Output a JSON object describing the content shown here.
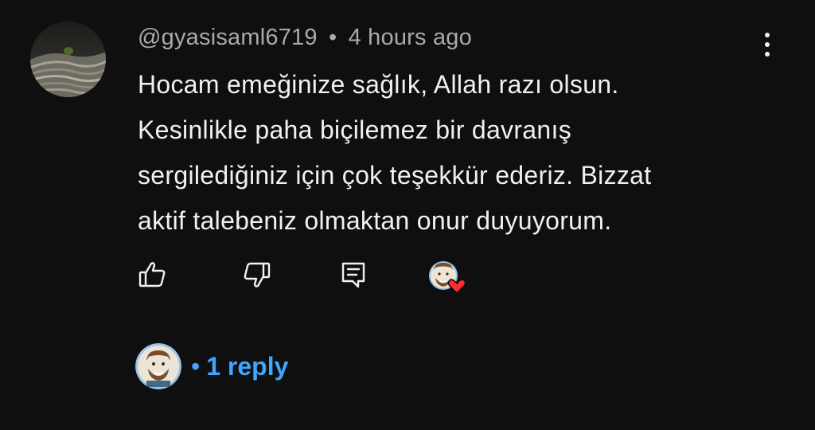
{
  "comment": {
    "author": "@gyasisaml6719",
    "separator": "•",
    "time": "4 hours ago",
    "lines": [
      "Hocam emeğinize sağlık, Allah razı olsun.",
      "Kesinlikle paha biçilemez bir davranış",
      "sergilediğiniz için çok teşekkür ederiz. Bizzat",
      "aktif talebeniz olmaktan onur duyuyorum."
    ]
  },
  "actions": {
    "like_icon": "thumbs-up-icon",
    "dislike_icon": "thumbs-down-icon",
    "reply_icon": "comment-reply-icon",
    "creator_heart_icon": "creator-heart-icon"
  },
  "replies": {
    "dot": "•",
    "label": "1 reply"
  },
  "colors": {
    "background": "#0f0f0f",
    "text": "#f1f1f1",
    "meta": "#aaaaaa",
    "link": "#3ea6ff",
    "heart": "#ff2d2d"
  }
}
